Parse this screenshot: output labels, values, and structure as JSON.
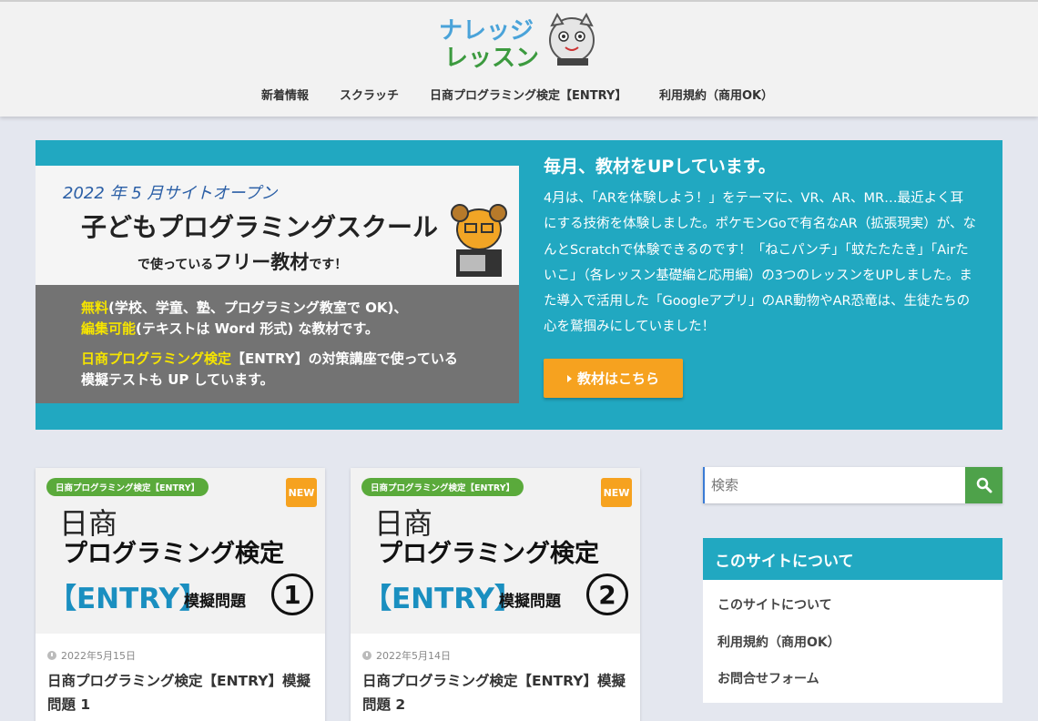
{
  "header": {
    "logo_line1": "ナレッジ",
    "logo_line2": "レッスン",
    "nav": [
      "新着情報",
      "スクラッチ",
      "日商プログラミング検定【ENTRY】",
      "利用規約（商用OK）"
    ]
  },
  "hero": {
    "banner": {
      "open": "2022 年 5 月サイトオープン",
      "title": "子どもプログラミングスクール",
      "sub_a": "で使っている",
      "sub_b": "フリー教材",
      "sub_c": "です！",
      "l1_hl": "無料",
      "l1_rest": "(学校、学童、塾、プログラミング教室で OK)、",
      "l2_hl": "編集可能",
      "l2_rest": "(テキストは Word 形式) な教材です。",
      "l3_hl": "日商プログラミング検定",
      "l3_rest": "【ENTRY】の対策講座で使っている",
      "l4": "模擬テストも UP しています。"
    },
    "heading": "毎月、教材をUPしています。",
    "text": "4月は、「ARを体験しよう！」をテーマに、VR、AR、MR…最近よく耳にする技術を体験しました。ポケモンGoで有名なAR（拡張現実）が、なんとScratchで体験できるのです！「ねこパンチ」「蚊たたたき」「Airたいこ」（各レッスン基礎編と応用編）の3つのレッスンをUPしました。また導入で活用した「Googleアプリ」のAR動物やAR恐竜は、生徒たちの心を鷲掴みにしていました！",
    "button": "教材はこちら"
  },
  "cards": [
    {
      "category": "日商プログラミング検定【ENTRY】",
      "new": "NEW",
      "thumb_nissho": "日商",
      "thumb_pg": "プログラミング検定",
      "thumb_entry": "【ENTRY】",
      "thumb_mogi": "模擬問題",
      "thumb_num": "1",
      "date": "2022年5月15日",
      "title": "日商プログラミング検定【ENTRY】模擬問題 1"
    },
    {
      "category": "日商プログラミング検定【ENTRY】",
      "new": "NEW",
      "thumb_nissho": "日商",
      "thumb_pg": "プログラミング検定",
      "thumb_entry": "【ENTRY】",
      "thumb_mogi": "模擬問題",
      "thumb_num": "2",
      "date": "2022年5月14日",
      "title": "日商プログラミング検定【ENTRY】模擬問題 2"
    }
  ],
  "sidebar": {
    "search_placeholder": "検索",
    "widget_title": "このサイトについて",
    "links": [
      "このサイトについて",
      "利用規約（商用OK）",
      "お問合せフォーム"
    ]
  },
  "colors": {
    "teal": "#21a8c1",
    "orange": "#f6a21f",
    "green": "#5aaa3b"
  }
}
